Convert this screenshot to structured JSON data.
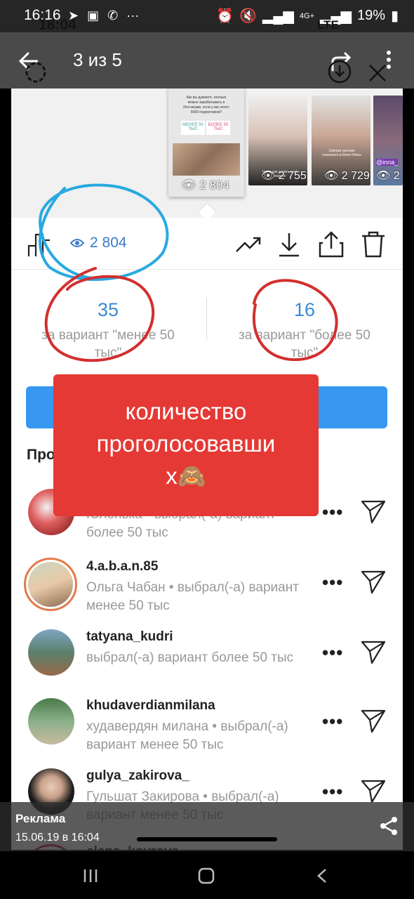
{
  "status_bar": {
    "time": "16:16",
    "battery": "19%",
    "network": "4G+",
    "ghost_time": "18:04",
    "ghost_network": "LTE"
  },
  "viewer": {
    "counter": "3 из 5"
  },
  "thumbnails": {
    "active": {
      "question": "Как вы думаете, сколько можно зарабатывать в Инстаграм, если у вас всего 5000 подписчиков?",
      "option_less": "МЕНЕЕ 50 ТЫС",
      "option_more": "БОЛЕЕ 50 ТЫС",
      "views": "2 804"
    },
    "others": [
      {
        "views": "2 755",
        "caption": "Что и как делать этой неделе"
      },
      {
        "views": "2 729",
        "caption": "Смотри сколько полезного в блоге Инны"
      },
      {
        "views": "2",
        "caption": "@inna_"
      }
    ]
  },
  "insights": {
    "views": "2 804"
  },
  "poll": {
    "left": {
      "count": "35",
      "label": "за вариант \"менее 50 тыс\""
    },
    "right": {
      "count": "16",
      "label": "за вариант \"более 50 тыс\""
    }
  },
  "section_title": "Про",
  "voters": [
    {
      "username": "",
      "detail": "Юленька • выбрал(-а) вариант более 50 тыс"
    },
    {
      "username": "4.a.b.a.n.85",
      "detail": "Ольга Чабан • выбрал(-а) вариант менее 50 тыс"
    },
    {
      "username": "tatyana_kudri",
      "detail": "выбрал(-а) вариант более 50 тыс"
    },
    {
      "username": "khudaverdianmilana",
      "detail": "худавердян милана • выбрал(-а) вариант менее 50 тыс"
    },
    {
      "username": "gulya_zakirova_",
      "detail": "Гульшат Закирова • выбрал(-а) вариант менее 50 тыс"
    },
    {
      "username": "elena_kovrova",
      "detail": ""
    }
  ],
  "overlay": {
    "line1": "количество",
    "line2": "проголосовавши",
    "line3": "х🙈"
  },
  "ad": {
    "label": "Реклама",
    "date": "15.06.19 в 16:04"
  },
  "colors": {
    "accent_blue": "#3897f0",
    "views_blue": "#3a7cc8",
    "red_card": "#e53935",
    "annotation_red": "#d32f2f",
    "annotation_blue": "#29a9e1"
  }
}
